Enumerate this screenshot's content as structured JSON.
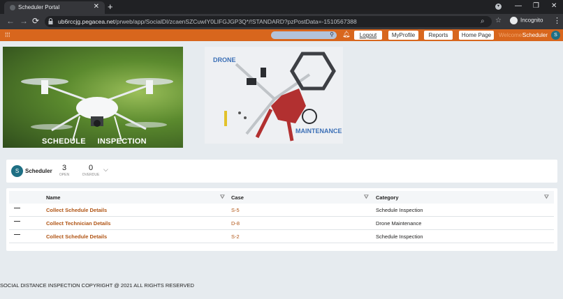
{
  "browser": {
    "tab_title": "Scheduler Portal",
    "url_host": "ub6rccjg.pegacea.net",
    "url_path": "/prweb/app/SocialDI/zcaenSZCuwIY0LIFGJGP3Q*/!STANDARD?pzPostData=-1510567388",
    "mode_label": "Incognito"
  },
  "appbar": {
    "nav": [
      "Logout",
      "MyProfile",
      "Reports",
      "Home Page"
    ],
    "welcome": "Welcome!",
    "user": "Scheduler",
    "user_initial": "S"
  },
  "hero": {
    "left_caption": "SCHEDULE     INSPECTION",
    "right_top_label": "DRONE",
    "right_bottom_label": "MAINTENANCE"
  },
  "status": {
    "operator": "Scheduler",
    "initial": "S",
    "open_count": "3",
    "open_label": "OPEN",
    "overdue_count": "0",
    "overdue_label": "OVERDUE"
  },
  "table": {
    "headers": [
      "Name",
      "Case",
      "Category"
    ],
    "rows": [
      {
        "name": "Collect Schedule Details",
        "case": "S-5",
        "category": "Schedule Inspection"
      },
      {
        "name": "Collect Technician Details",
        "case": "D-8",
        "category": "Drone Maintenance"
      },
      {
        "name": "Collect Schedule Details",
        "case": "S-2",
        "category": "Schedule Inspection"
      }
    ]
  },
  "footer": "SOCIAL DISTANCE INSPECTION COPYRIGHT @ 2021 ALL RIGHTS RESERVED",
  "colors": {
    "accent": "#d8661d",
    "link": "#b05414",
    "avatar": "#1e6f84"
  }
}
